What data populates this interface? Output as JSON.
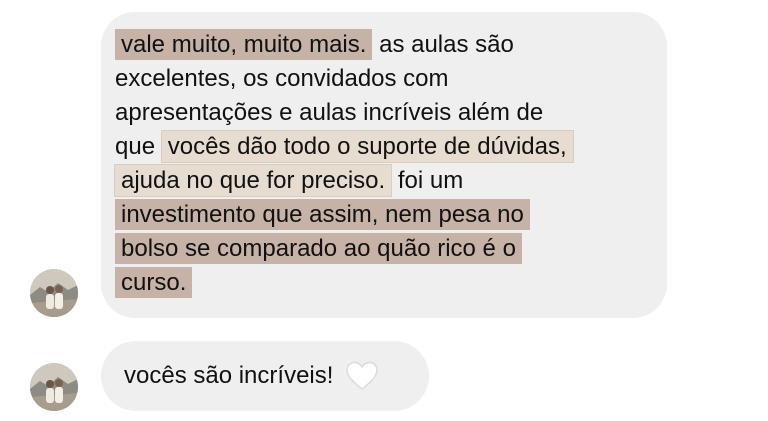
{
  "messages": [
    {
      "lines": [
        [
          {
            "text": "vale muito, muito mais.",
            "highlight": "dark"
          },
          {
            "text": " as aulas são",
            "highlight": "none"
          }
        ],
        [
          {
            "text": "excelentes, os convidados com",
            "highlight": "none"
          }
        ],
        [
          {
            "text": "apresentações e aulas incríveis além de",
            "highlight": "none"
          }
        ],
        [
          {
            "text": "que ",
            "highlight": "none"
          },
          {
            "text": "vocês dão todo o suporte de dúvidas,",
            "highlight": "light"
          }
        ],
        [
          {
            "text": "ajuda no que for preciso.",
            "highlight": "light"
          },
          {
            "text": " foi um",
            "highlight": "none"
          }
        ],
        [
          {
            "text": "investimento que assim, nem pesa no",
            "highlight": "dark"
          }
        ],
        [
          {
            "text": "bolso se comparado ao quão rico é o",
            "highlight": "dark"
          }
        ],
        [
          {
            "text": "curso.",
            "highlight": "dark"
          }
        ]
      ]
    },
    {
      "text": "vocês são incríveis!",
      "emoji": "white-heart-icon"
    }
  ],
  "colors": {
    "bubble": "#efefef",
    "highlight_dark": "#c6b2a6",
    "highlight_light": "#e6dccf",
    "text": "#111111"
  }
}
